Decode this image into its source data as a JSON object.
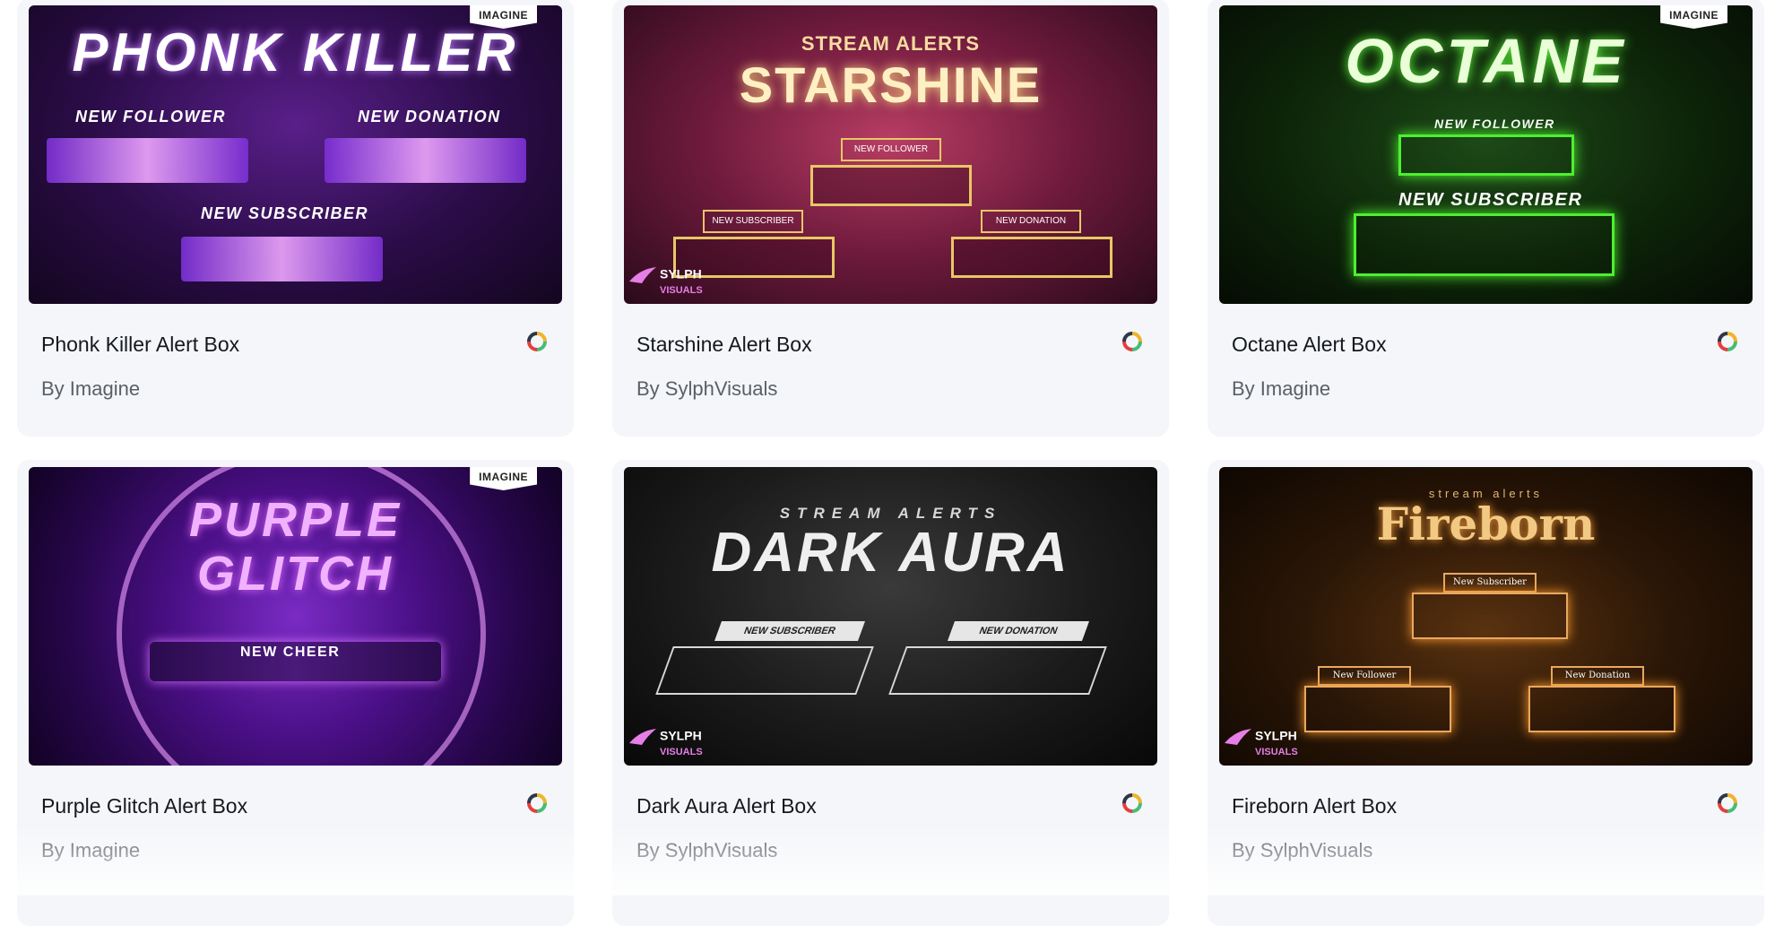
{
  "cards": [
    {
      "title": "Phonk Killer Alert Box",
      "author": "By Imagine",
      "badge": "IMAGINE",
      "headline": "PHONK KILLER",
      "labels": [
        "NEW FOLLOWER",
        "NEW DONATION",
        "NEW SUBSCRIBER"
      ]
    },
    {
      "title": "Starshine Alert Box",
      "author": "By SylphVisuals",
      "pretitle": "STREAM ALERTS",
      "headline": "STARSHINE",
      "labels": [
        "NEW FOLLOWER",
        "NEW SUBSCRIBER",
        "NEW DONATION"
      ],
      "logo": "SYLPH",
      "logo_sub": "VISUALS"
    },
    {
      "title": "Octane Alert Box",
      "author": "By Imagine",
      "badge": "IMAGINE",
      "headline": "OCTANE",
      "labels": [
        "NEW FOLLOWER",
        "NEW SUBSCRIBER"
      ]
    },
    {
      "title": "Purple Glitch Alert Box",
      "author": "By Imagine",
      "badge": "IMAGINE",
      "headline": "PURPLE",
      "headline2": "GLITCH",
      "labels": [
        "NEW CHEER"
      ]
    },
    {
      "title": "Dark Aura Alert Box",
      "author": "By SylphVisuals",
      "pretitle": "STREAM ALERTS",
      "headline": "DARK AURA",
      "labels": [
        "NEW SUBSCRIBER",
        "NEW DONATION"
      ],
      "logo": "SYLPH",
      "logo_sub": "VISUALS"
    },
    {
      "title": "Fireborn Alert Box",
      "author": "By SylphVisuals",
      "pretitle": "stream alerts",
      "headline": "Fireborn",
      "labels": [
        "New Subscriber",
        "New Follower",
        "New Donation"
      ],
      "logo": "SYLPH",
      "logo_sub": "VISUALS"
    }
  ],
  "colors": {
    "card_bg": "#f4f6f9",
    "title": "#15181d",
    "author": "#5a6068"
  },
  "icons": {
    "status": "loading-spinner-icon",
    "logo": "wing-icon"
  }
}
